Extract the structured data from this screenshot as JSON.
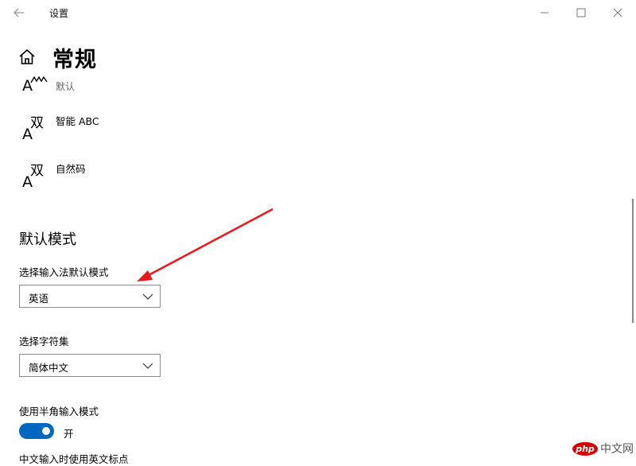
{
  "window": {
    "title": "设置",
    "back_icon": "arrow-left-icon",
    "minimize_icon": "minimize-icon",
    "maximize_icon": "maximize-icon",
    "close_icon": "close-icon"
  },
  "page": {
    "title": "常规",
    "icon": "home-icon"
  },
  "ime_list": [
    {
      "name": "",
      "subtitle": "默认",
      "icon": "ime-icon"
    },
    {
      "name": "智能 ABC",
      "subtitle": "",
      "icon": "ime-icon"
    },
    {
      "name": "自然码",
      "subtitle": "",
      "icon": "ime-icon"
    }
  ],
  "icon_glyphs": {
    "big_a": "A",
    "shuang": "双"
  },
  "default_mode": {
    "heading": "默认模式",
    "input_mode_label": "选择输入法默认模式",
    "input_mode_value": "英语",
    "charset_label": "选择字符集",
    "charset_value": "简体中文",
    "halfwidth_label": "使用半角输入模式",
    "halfwidth_state": "开",
    "halfwidth_on": true,
    "next_label_partial": "中文输入时使用英文标点"
  },
  "annotation": {
    "arrow_color": "#e8191c"
  },
  "watermark": {
    "logo": "php",
    "text": "中文网"
  },
  "colors": {
    "accent": "#0067c0",
    "dropdown_border": "#8a8a8a"
  }
}
